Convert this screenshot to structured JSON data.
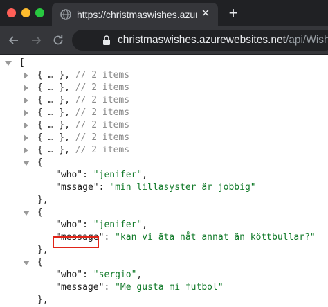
{
  "browser": {
    "tab_title": "https://christmaswishes.azurewebsites.net/api/Wishes",
    "tab_close_icon": "close-icon",
    "new_tab_icon": "plus-icon",
    "url_host": "christmaswishes.azurewebsites.net",
    "url_path": "/api/Wishes",
    "icons": [
      "back-arrow-icon",
      "forward-arrow-icon",
      "reload-icon",
      "lock-icon",
      "globe-icon"
    ]
  },
  "json_view": {
    "lines": [
      {
        "indent": 0,
        "toggle": "open",
        "parts": [
          {
            "t": "[",
            "c": "p"
          }
        ]
      },
      {
        "indent": 1,
        "toggle": "closed",
        "parts": [
          {
            "t": "{ … }, ",
            "c": "p"
          },
          {
            "t": "// 2 items",
            "c": "comment"
          }
        ]
      },
      {
        "indent": 1,
        "toggle": "closed",
        "parts": [
          {
            "t": "{ … }, ",
            "c": "p"
          },
          {
            "t": "// 2 items",
            "c": "comment"
          }
        ]
      },
      {
        "indent": 1,
        "toggle": "closed",
        "parts": [
          {
            "t": "{ … }, ",
            "c": "p"
          },
          {
            "t": "// 2 items",
            "c": "comment"
          }
        ]
      },
      {
        "indent": 1,
        "toggle": "closed",
        "parts": [
          {
            "t": "{ … }, ",
            "c": "p"
          },
          {
            "t": "// 2 items",
            "c": "comment"
          }
        ]
      },
      {
        "indent": 1,
        "toggle": "closed",
        "parts": [
          {
            "t": "{ … }, ",
            "c": "p"
          },
          {
            "t": "// 2 items",
            "c": "comment"
          }
        ]
      },
      {
        "indent": 1,
        "toggle": "closed",
        "parts": [
          {
            "t": "{ … }, ",
            "c": "p"
          },
          {
            "t": "// 2 items",
            "c": "comment"
          }
        ]
      },
      {
        "indent": 1,
        "toggle": "closed",
        "parts": [
          {
            "t": "{ … }, ",
            "c": "p"
          },
          {
            "t": "// 2 items",
            "c": "comment"
          }
        ]
      },
      {
        "indent": 1,
        "toggle": "open",
        "parts": [
          {
            "t": "{",
            "c": "p"
          }
        ]
      },
      {
        "indent": 2,
        "toggle": "",
        "parts": [
          {
            "t": "\"who\"",
            "c": "key"
          },
          {
            "t": ": ",
            "c": "p"
          },
          {
            "t": "\"jenifer\"",
            "c": "str"
          },
          {
            "t": ",",
            "c": "p"
          }
        ]
      },
      {
        "indent": 2,
        "toggle": "",
        "parts": [
          {
            "t": "\"mssage\"",
            "c": "key"
          },
          {
            "t": ": ",
            "c": "p"
          },
          {
            "t": "\"min lillasyster är jobbig\"",
            "c": "str"
          }
        ]
      },
      {
        "indent": 1,
        "toggle": "",
        "parts": [
          {
            "t": "},",
            "c": "p"
          }
        ]
      },
      {
        "indent": 1,
        "toggle": "open",
        "parts": [
          {
            "t": "{",
            "c": "p"
          }
        ]
      },
      {
        "indent": 2,
        "toggle": "",
        "parts": [
          {
            "t": "\"who\"",
            "c": "key"
          },
          {
            "t": ": ",
            "c": "p"
          },
          {
            "t": "\"jenifer\"",
            "c": "str"
          },
          {
            "t": ",",
            "c": "p"
          }
        ]
      },
      {
        "indent": 2,
        "toggle": "",
        "parts": [
          {
            "t": "\"message\"",
            "c": "key"
          },
          {
            "t": ": ",
            "c": "p"
          },
          {
            "t": "\"kan vi äta nåt annat än köttbullar?\"",
            "c": "str"
          }
        ]
      },
      {
        "indent": 1,
        "toggle": "",
        "parts": [
          {
            "t": "},",
            "c": "p"
          }
        ]
      },
      {
        "indent": 1,
        "toggle": "open",
        "parts": [
          {
            "t": "{",
            "c": "p"
          }
        ]
      },
      {
        "indent": 2,
        "toggle": "",
        "parts": [
          {
            "t": "\"who\"",
            "c": "key"
          },
          {
            "t": ": ",
            "c": "p"
          },
          {
            "t": "\"sergio\"",
            "c": "str"
          },
          {
            "t": ",",
            "c": "p"
          }
        ]
      },
      {
        "indent": 2,
        "toggle": "",
        "parts": [
          {
            "t": "\"message\"",
            "c": "key"
          },
          {
            "t": ": ",
            "c": "p"
          },
          {
            "t": "\"Me gusta mi futbol\"",
            "c": "str"
          }
        ]
      },
      {
        "indent": 1,
        "toggle": "",
        "parts": [
          {
            "t": "},",
            "c": "p"
          }
        ]
      }
    ]
  },
  "colors": {
    "string": "#137b2b",
    "comment": "#8a8a8a",
    "highlight_box": "#e02418"
  }
}
